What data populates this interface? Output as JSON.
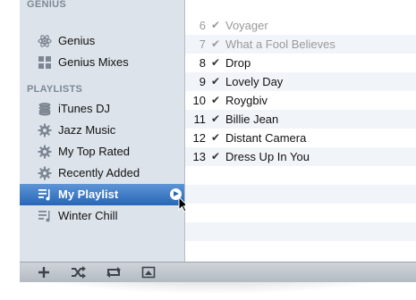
{
  "sidebar": {
    "genius_header": "GENIUS",
    "playlists_header": "PLAYLISTS",
    "genius_items": [
      {
        "label": "Genius",
        "icon": "genius-atom-icon"
      },
      {
        "label": "Genius Mixes",
        "icon": "genius-mixes-grid-icon"
      }
    ],
    "playlist_items": [
      {
        "label": "iTunes DJ",
        "icon": "itunes-dj-icon"
      },
      {
        "label": "Jazz Music",
        "icon": "smart-playlist-gear-icon"
      },
      {
        "label": "My Top Rated",
        "icon": "smart-playlist-gear-icon"
      },
      {
        "label": "Recently Added",
        "icon": "smart-playlist-gear-icon"
      },
      {
        "label": "My Playlist",
        "icon": "playlist-icon",
        "selected": true
      },
      {
        "label": "Winter Chill",
        "icon": "playlist-icon"
      }
    ],
    "selection_color": "#2866b6"
  },
  "tracks": [
    {
      "num": "6",
      "check": "✔",
      "title": "Voyager"
    },
    {
      "num": "7",
      "check": "✔",
      "title": "What a Fool Believes"
    },
    {
      "num": "8",
      "check": "✔",
      "title": "Drop"
    },
    {
      "num": "9",
      "check": "✔",
      "title": "Lovely Day"
    },
    {
      "num": "10",
      "check": "✔",
      "title": "Roygbiv"
    },
    {
      "num": "11",
      "check": "✔",
      "title": "Billie Jean"
    },
    {
      "num": "12",
      "check": "✔",
      "title": "Distant Camera"
    },
    {
      "num": "13",
      "check": "✔",
      "title": "Dress Up In You"
    }
  ],
  "bottom_bar": {
    "buttons": [
      "add-playlist-icon",
      "shuffle-icon",
      "repeat-icon",
      "artwork-toggle-icon"
    ]
  }
}
